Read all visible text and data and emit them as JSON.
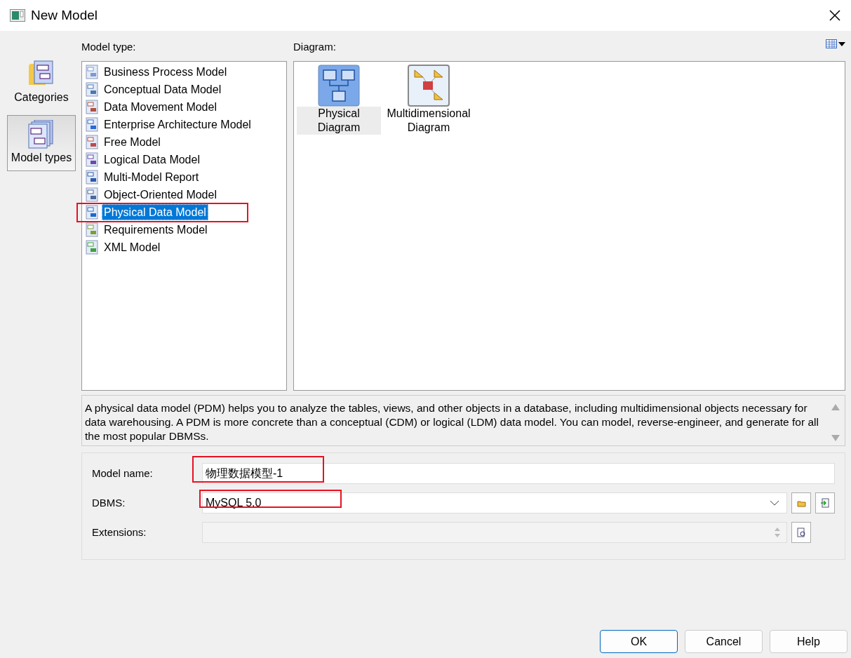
{
  "window": {
    "title": "New Model"
  },
  "sidebar": {
    "items": [
      {
        "label": "Categories",
        "selected": false
      },
      {
        "label": "Model types",
        "selected": true
      }
    ]
  },
  "model_type": {
    "label": "Model type:",
    "items": [
      {
        "label": "Business Process Model",
        "selected": false,
        "highlighted": false
      },
      {
        "label": "Conceptual Data Model",
        "selected": false,
        "highlighted": false
      },
      {
        "label": "Data Movement Model",
        "selected": false,
        "highlighted": false
      },
      {
        "label": "Enterprise Architecture Model",
        "selected": false,
        "highlighted": false
      },
      {
        "label": "Free Model",
        "selected": false,
        "highlighted": false
      },
      {
        "label": "Logical Data Model",
        "selected": false,
        "highlighted": false
      },
      {
        "label": "Multi-Model Report",
        "selected": false,
        "highlighted": false
      },
      {
        "label": "Object-Oriented Model",
        "selected": false,
        "highlighted": false
      },
      {
        "label": "Physical Data Model",
        "selected": true,
        "highlighted": true
      },
      {
        "label": "Requirements Model",
        "selected": false,
        "highlighted": false
      },
      {
        "label": "XML Model",
        "selected": false,
        "highlighted": false
      }
    ]
  },
  "diagram": {
    "label": "Diagram:",
    "items": [
      {
        "label": "Physical Diagram",
        "selected": true
      },
      {
        "label": "Multidimensional Diagram",
        "selected": false
      }
    ]
  },
  "description": "A physical data model (PDM) helps you to analyze the tables, views, and other objects in a database, including multidimensional objects necessary for data warehousing. A PDM is more concrete than a conceptual (CDM) or logical (LDM) data model. You can model, reverse-engineer, and generate for all the most popular DBMSs.",
  "form": {
    "model_name": {
      "label": "Model name:",
      "value": "物理数据模型-1",
      "highlighted": true
    },
    "dbms": {
      "label": "DBMS:",
      "value": "MySQL 5.0",
      "highlighted": true
    },
    "extensions": {
      "label": "Extensions:",
      "disabled": true
    }
  },
  "buttons": [
    {
      "label": "OK",
      "kind": "default"
    },
    {
      "label": "Cancel",
      "kind": "normal"
    },
    {
      "label": "Help",
      "kind": "normal"
    }
  ]
}
